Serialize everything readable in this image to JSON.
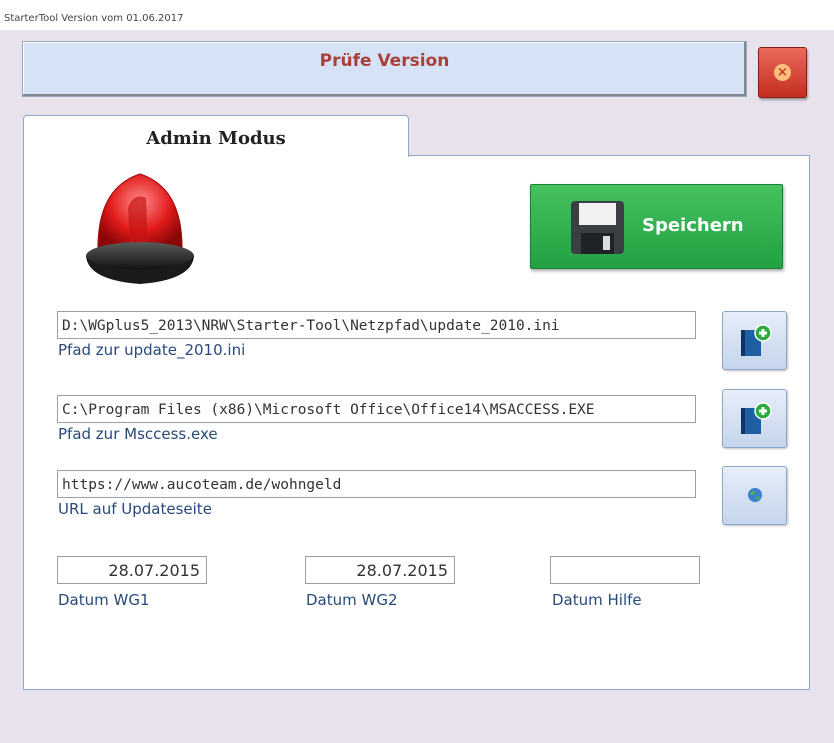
{
  "window": {
    "title": "StarterTool Version vom 01.06.2017"
  },
  "header": {
    "title": "Prüfe Version"
  },
  "close_button": {
    "icon": "close-icon",
    "color": "#c42d21"
  },
  "tab": {
    "label": "Admin Modus"
  },
  "save_button": {
    "label": "Speichern",
    "icon": "floppy-disk-icon",
    "color": "#2bb04c"
  },
  "alarm": {
    "icon": "siren-icon"
  },
  "paths": {
    "update_ini": {
      "value": "D:\\WGplus5_2013\\NRW\\Starter-Tool\\Netzpfad\\update_2010.ini",
      "caption": "Pfad zur update_2010.ini",
      "button_icon": "add-book-icon"
    },
    "msaccess": {
      "value": "C:\\Program Files (x86)\\Microsoft Office\\Office14\\MSACCESS.EXE",
      "caption": "Pfad zur Msccess.exe",
      "button_icon": "add-book-icon"
    },
    "url": {
      "value": "https://www.aucoteam.de/wohngeld",
      "caption": "URL auf Updateseite",
      "button_icon": "globe-icon"
    }
  },
  "dates": {
    "wg1": {
      "value": "28.07.2015",
      "caption": "Datum WG1"
    },
    "wg2": {
      "value": "28.07.2015",
      "caption": "Datum WG2"
    },
    "hilfe": {
      "value": "",
      "caption": "Datum Hilfe"
    }
  }
}
